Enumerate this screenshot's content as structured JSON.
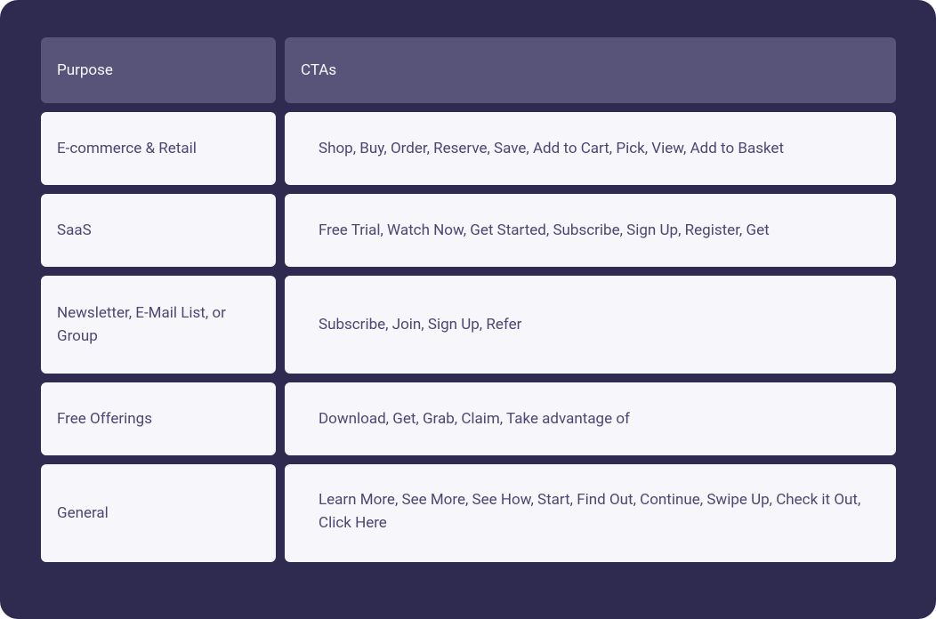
{
  "headers": {
    "purpose": "Purpose",
    "ctas": "CTAs"
  },
  "rows": [
    {
      "purpose": "E-commerce & Retail",
      "ctas": "Shop, Buy, Order, Reserve, Save, Add to Cart, Pick, View, Add to Basket"
    },
    {
      "purpose": "SaaS",
      "ctas": "Free Trial, Watch Now, Get Started, Subscribe, Sign Up, Register, Get"
    },
    {
      "purpose": "Newsletter, E-Mail List, or Group",
      "ctas": "Subscribe, Join, Sign Up, Refer"
    },
    {
      "purpose": "Free Offerings",
      "ctas": "Download, Get, Grab, Claim, Take advantage of"
    },
    {
      "purpose": "General",
      "ctas": "Learn More, See More, See How, Start, Find Out, Continue, Swipe Up, Check it Out, Click Here"
    }
  ]
}
